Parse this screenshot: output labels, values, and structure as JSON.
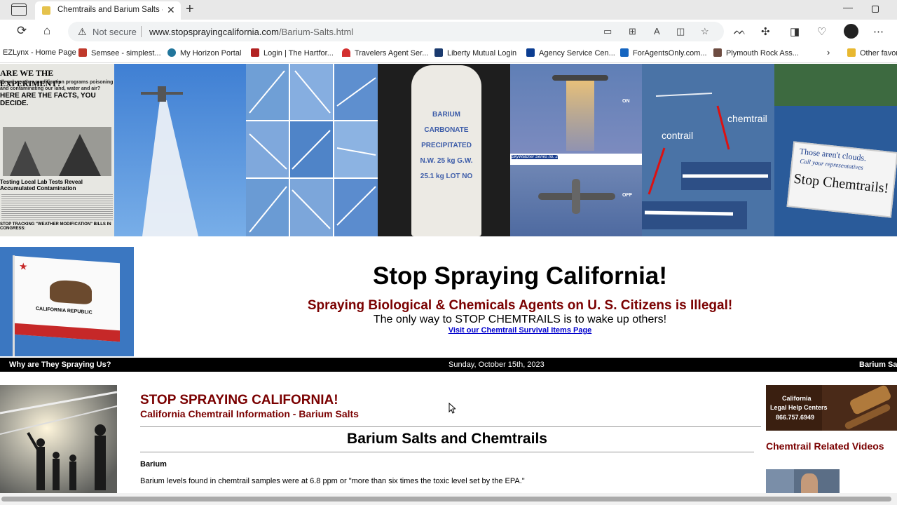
{
  "browser": {
    "tab_title": "Chemtrails and Barium Salts - Ch",
    "security_label": "Not secure",
    "url_host": "www.stopsprayingcalifornia.com",
    "url_path": "/Barium-Salts.html"
  },
  "bookmarks": [
    {
      "label": "EZLynx - Home Page",
      "color": "#ffffff"
    },
    {
      "label": "Semsee - simplest...",
      "color": "#c0392b"
    },
    {
      "label": "My Horizon Portal",
      "color": "#21759b"
    },
    {
      "label": "Login | The Hartfor...",
      "color": "#b22222"
    },
    {
      "label": "Travelers Agent Ser...",
      "color": "#d32f2f"
    },
    {
      "label": "Liberty Mutual Login",
      "color": "#1a3a6e"
    },
    {
      "label": "Agency Service Cen...",
      "color": "#0b3d91"
    },
    {
      "label": "ForAgentsOnly.com...",
      "color": "#1565c0"
    },
    {
      "label": "Plymouth Rock Ass...",
      "color": "#6d4c41"
    }
  ],
  "bookmarks_other": "Other favor",
  "banner": {
    "newspaper_headline": "ARE WE THE EXPERIMENT?",
    "newspaper_line1": "Illegal weather modification programs poisoning",
    "newspaper_line2": "and contaminating our land, water and air?",
    "newspaper_line3": "HERE ARE THE FACTS, YOU DECIDE.",
    "newspaper_mid": "Testing Local Lab Tests Reveal Accumulated Contamination",
    "newspaper_bottom": "STOP TRACKING \"WEATHER MODIFICATION\" BILLS IN CONGRESS:",
    "bag_text": "BARIUM CARBONATE PRECIPITATED N.W. 25 kg G.W. 25.1 kg LOT NO",
    "skywatcher_caption": "SkyWatcher Series no. 2",
    "on_label": "ON",
    "off_label": "OFF",
    "contrail_label": "contrail",
    "chemtrail_label": "chemtrail",
    "sticker_line1": "Those aren't clouds.",
    "sticker_line2": "Call your representatives",
    "sticker_line3": "Stop Chemtrails!"
  },
  "flag_text": "CALIFORNIA REPUBLIC",
  "header": {
    "title": "Stop Spraying California!",
    "subtitle": "Spraying Biological & Chemicals Agents on U. S. Citizens is Illegal!",
    "tagline": "The only way to STOP CHEMTRAILS is to wake up others!",
    "link": "Visit our Chemtrail Survival Items Page"
  },
  "blackbar": {
    "left": "Why are They Spraying Us?",
    "date": "Sunday, October 15th, 2023",
    "right": "Barium Salts"
  },
  "content": {
    "heading1": "STOP SPRAYING CALIFORNIA!",
    "heading2": "California Chemtrail Information - Barium Salts",
    "main_heading": "Barium Salts and Chemtrails",
    "subheading": "Barium",
    "paragraph": "Barium levels found in chemtrail samples were at 6.8 ppm or \"more than six times the toxic level set by the EPA.\""
  },
  "sidebar": {
    "ad_line1": "California",
    "ad_line2": "Legal Help Centers",
    "ad_line3": "866.757.6949",
    "videos_heading": "Chemtrail Related Videos"
  }
}
